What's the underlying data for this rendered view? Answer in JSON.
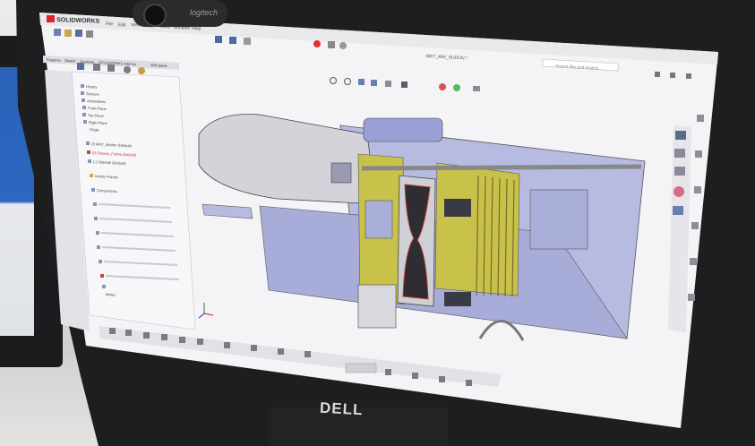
{
  "app": {
    "brand_prefix": "3S",
    "brand_name": "SOLIDWORKS",
    "document_title": "4807_MW_SUDON *",
    "search_placeholder": "Search files and models",
    "menu_items": [
      "File",
      "Edit",
      "View",
      "Insert",
      "Tools",
      "Window",
      "Help"
    ]
  },
  "command_tabs": [
    "Features",
    "Sketch",
    "Evaluate",
    "SOLIDWORKS Add-Ins",
    "3DExperie"
  ],
  "feature_tree": {
    "items": [
      "History",
      "Sensors",
      "Annotations",
      "Front Plane",
      "Top Plane",
      "Right Plane",
      "Origin",
      "(f) 4807_Mother (Default)",
      "(f) Chassis_Frame (Default)",
      "(-) Sidewall (Default)",
      "Interior Panels",
      "Components",
      "Mates"
    ]
  },
  "webcam": {
    "brand": "logitech"
  },
  "monitor": {
    "brand": "DELL"
  },
  "colors": {
    "viewport_bg": "#f2f2f4",
    "part_blue": "#9aa0d6",
    "part_yellow": "#c9c24a",
    "part_grey": "#cfcfd6",
    "door_dark": "#2d2d33",
    "door_accent": "#c0392b",
    "solidworks_red": "#d9262b"
  }
}
